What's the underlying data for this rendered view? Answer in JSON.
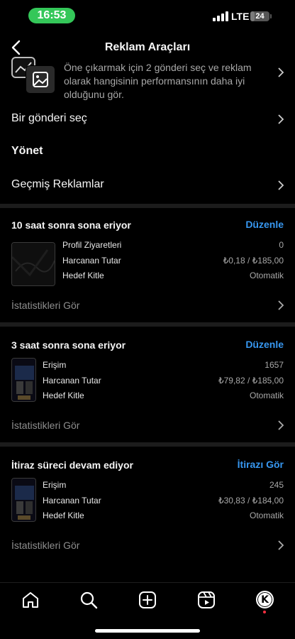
{
  "status_bar": {
    "time": "16:53",
    "network": "LTE",
    "battery": "24",
    "battery_level": 0.24
  },
  "header": {
    "title": "Reklam Araçları"
  },
  "compare": {
    "text": "Öne çıkarmak için 2 gönderi seç ve reklam olarak hangisinin performansının daha iyi olduğunu gör."
  },
  "menu": {
    "select_post": "Bir gönderi seç",
    "manage": "Yönet",
    "past_ads": "Geçmiş Reklamlar"
  },
  "ads": [
    {
      "status": "10 saat sonra sona eriyor",
      "action": "Düzenle",
      "metrics": [
        {
          "label": "Profil Ziyaretleri",
          "value": "0"
        },
        {
          "label": "Harcanan Tutar",
          "value": "₺0,18 / ₺185,00"
        },
        {
          "label": "Hedef Kitle",
          "value": "Otomatik"
        }
      ],
      "stats_link": "İstatistikleri Gör"
    },
    {
      "status": "3 saat sonra sona eriyor",
      "action": "Düzenle",
      "metrics": [
        {
          "label": "Erişim",
          "value": "1657"
        },
        {
          "label": "Harcanan Tutar",
          "value": "₺79,82 / ₺185,00"
        },
        {
          "label": "Hedef Kitle",
          "value": "Otomatik"
        }
      ],
      "stats_link": "İstatistikleri Gör"
    },
    {
      "status": "İtiraz süreci devam ediyor",
      "action": "İtirazı Gör",
      "metrics": [
        {
          "label": "Erişim",
          "value": "245"
        },
        {
          "label": "Harcanan Tutar",
          "value": "₺30,83 / ₺184,00"
        },
        {
          "label": "Hedef Kitle",
          "value": "Otomatik"
        }
      ],
      "stats_link": "İstatistikleri Gör"
    }
  ],
  "tab_bar": {
    "items": [
      "home-icon",
      "search-icon",
      "create-icon",
      "reels-icon",
      "profile-avatar"
    ],
    "avatar_letter": "K"
  },
  "colors": {
    "accent": "#3797f0",
    "status_pill": "#34c759",
    "background": "#000000",
    "notification": "#ff3040"
  }
}
